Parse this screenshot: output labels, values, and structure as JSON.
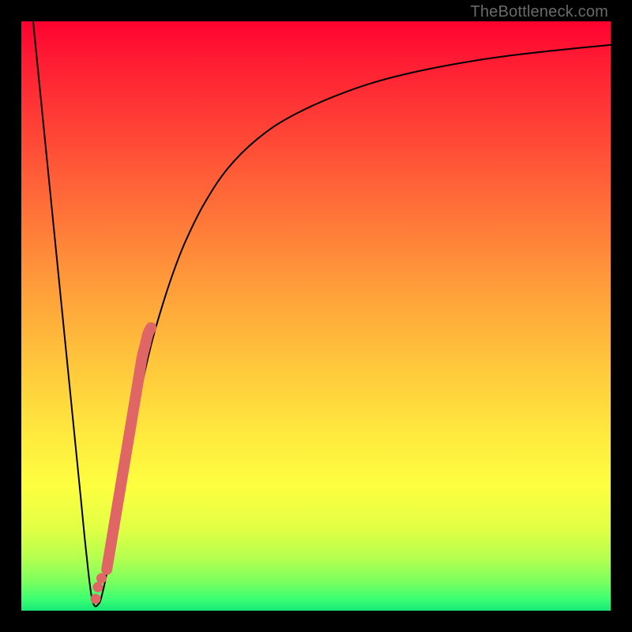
{
  "attribution": "TheBottleneck.com",
  "chart_data": {
    "type": "line",
    "title": "",
    "xlabel": "",
    "ylabel": "",
    "xlim": [
      0,
      100
    ],
    "ylim": [
      0,
      100
    ],
    "gradient_stops": [
      {
        "pos": 0,
        "color": "#ff0030"
      },
      {
        "pos": 17,
        "color": "#ff3e36"
      },
      {
        "pos": 44,
        "color": "#ff9a3a"
      },
      {
        "pos": 70,
        "color": "#ffe93e"
      },
      {
        "pos": 86,
        "color": "#e2ff44"
      },
      {
        "pos": 100,
        "color": "#18e877"
      }
    ],
    "series": [
      {
        "name": "bottleneck-curve",
        "x": [
          2,
          4,
          6,
          8,
          10,
          11,
          12,
          13,
          14,
          16,
          18,
          20,
          22,
          24,
          26,
          28,
          31,
          35,
          40,
          46,
          55,
          65,
          78,
          90,
          100
        ],
        "y": [
          100,
          80,
          60,
          40,
          20,
          10,
          2,
          1,
          4,
          14,
          25,
          36,
          45,
          52,
          58,
          63,
          69,
          75,
          80,
          84,
          88,
          91,
          93.5,
          95,
          96
        ]
      }
    ],
    "highlight_markers": {
      "name": "highlight-segment",
      "color": "#e06666",
      "x": [
        14.5,
        15,
        15.5,
        16,
        16.5,
        17,
        17.5,
        18,
        18.5,
        19,
        19.5,
        20,
        20.5,
        21,
        21.5,
        22
      ],
      "y": [
        7,
        10,
        13,
        16,
        19,
        22,
        25,
        28,
        31,
        34,
        37,
        40,
        43,
        45,
        47,
        48
      ]
    },
    "sparse_markers": {
      "name": "near-minimum-dots",
      "color": "#e06666",
      "x": [
        13.0,
        13.6,
        12.6
      ],
      "y": [
        4.0,
        5.5,
        2.0
      ]
    }
  }
}
